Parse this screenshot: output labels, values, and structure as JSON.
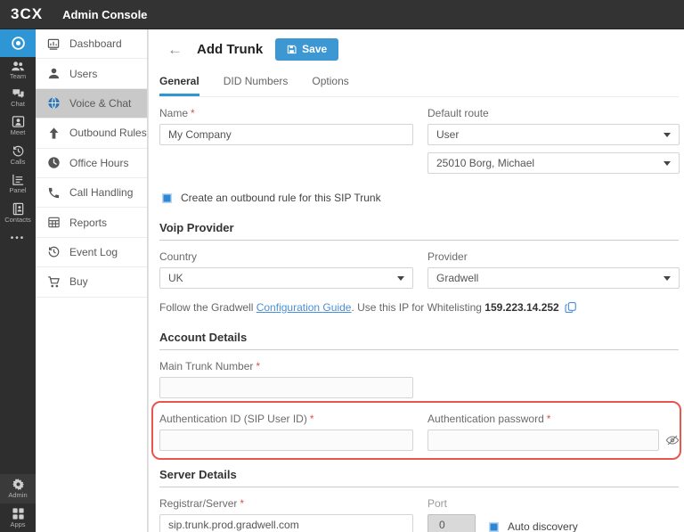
{
  "topbar": {
    "logo": "3CX",
    "title": "Admin Console"
  },
  "rail": {
    "items": [
      {
        "label": ""
      },
      {
        "label": "Team"
      },
      {
        "label": "Chat"
      },
      {
        "label": "Meet"
      },
      {
        "label": "Calls"
      },
      {
        "label": "Panel"
      },
      {
        "label": "Contacts"
      },
      {
        "label": "•••"
      },
      {
        "label": "Admin"
      },
      {
        "label": "Apps"
      }
    ]
  },
  "sidebar": {
    "items": [
      {
        "label": "Dashboard"
      },
      {
        "label": "Users"
      },
      {
        "label": "Voice & Chat"
      },
      {
        "label": "Outbound Rules"
      },
      {
        "label": "Office Hours"
      },
      {
        "label": "Call Handling"
      },
      {
        "label": "Reports"
      },
      {
        "label": "Event Log"
      },
      {
        "label": "Buy"
      }
    ]
  },
  "header": {
    "back": "←",
    "title": "Add Trunk",
    "save_label": "Save"
  },
  "tabs": [
    {
      "label": "General"
    },
    {
      "label": "DID Numbers"
    },
    {
      "label": "Options"
    }
  ],
  "form": {
    "required_mark": "*",
    "name": {
      "label": "Name",
      "value": "My Company"
    },
    "default_route": {
      "label": "Default route",
      "value": "User"
    },
    "route_target": {
      "value": "25010 Borg, Michael"
    },
    "outbound_rule": {
      "label": "Create an outbound rule for this SIP Trunk"
    },
    "voip": {
      "heading": "Voip Provider",
      "country_label": "Country",
      "country_value": "UK",
      "provider_label": "Provider",
      "provider_value": "Gradwell",
      "guide_prefix": "Follow the Gradwell ",
      "guide_link": "Configuration Guide",
      "guide_middle": ". Use this IP for Whitelisting ",
      "guide_ip": "159.223.14.252"
    },
    "account": {
      "heading": "Account Details",
      "main_trunk_label": "Main Trunk Number",
      "main_trunk_value": "",
      "auth_id_label": "Authentication ID (SIP User ID)",
      "auth_id_value": "",
      "auth_pw_label": "Authentication password",
      "auth_pw_value": ""
    },
    "server": {
      "heading": "Server Details",
      "registrar_label": "Registrar/Server",
      "registrar_value": "sip.trunk.prod.gradwell.com",
      "port_label": "Port",
      "port_value": "0",
      "auto_discovery_label": "Auto discovery"
    }
  },
  "colors": {
    "accent": "#2e96d5",
    "save_button": "#3d97d3",
    "annotation_red": "#e8564e",
    "link": "#4a90d9",
    "sidebar_selected": "#c9c9c9"
  }
}
